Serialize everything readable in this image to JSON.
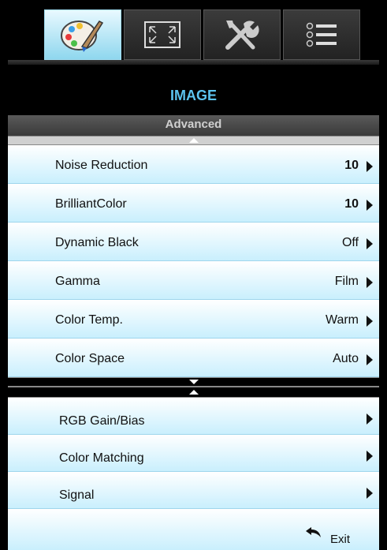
{
  "tabs": [
    {
      "id": "image",
      "icon": "palette-icon",
      "active": true
    },
    {
      "id": "display",
      "icon": "screen-expand-icon",
      "active": false
    },
    {
      "id": "setup",
      "icon": "tools-icon",
      "active": false
    },
    {
      "id": "options",
      "icon": "list-icon",
      "active": false
    }
  ],
  "menu": {
    "title": "IMAGE",
    "subtitle": "Advanced"
  },
  "items_top": [
    {
      "label": "Noise Reduction",
      "value": "10"
    },
    {
      "label": "BrilliantColor",
      "value": "10"
    },
    {
      "label": "Dynamic Black",
      "value": "Off"
    },
    {
      "label": "Gamma",
      "value": "Film"
    },
    {
      "label": "Color Temp.",
      "value": "Warm"
    },
    {
      "label": "Color Space",
      "value": "Auto"
    }
  ],
  "items_bottom": [
    {
      "label": "RGB Gain/Bias",
      "value": ""
    },
    {
      "label": "Color Matching",
      "value": ""
    },
    {
      "label": "Signal",
      "value": ""
    }
  ],
  "exit": {
    "label": "Exit",
    "icon": "back-arrow-icon"
  },
  "colors": {
    "accent": "#5cc3ee",
    "row_top": "#ffffff",
    "row_bottom": "#c9effd"
  }
}
